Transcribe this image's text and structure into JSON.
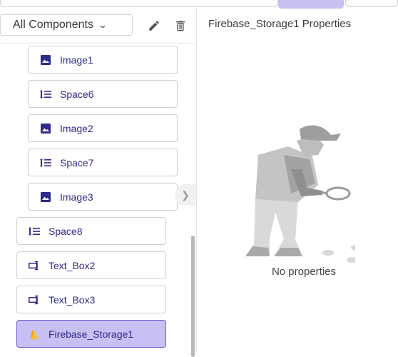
{
  "toolbar": {
    "filter_select": "All Components",
    "edit_icon": "pencil-icon",
    "delete_icon": "trash-icon"
  },
  "tree": {
    "items": [
      {
        "label": "Image1",
        "icon": "image-icon"
      },
      {
        "label": "Space6",
        "icon": "spacing-icon"
      },
      {
        "label": "Image2",
        "icon": "image-icon"
      },
      {
        "label": "Space7",
        "icon": "spacing-icon"
      },
      {
        "label": "Image3",
        "icon": "image-icon"
      },
      {
        "label": "Space8",
        "icon": "spacing-icon"
      },
      {
        "label": "Text_Box2",
        "icon": "textbox-icon"
      },
      {
        "label": "Text_Box3",
        "icon": "textbox-icon"
      },
      {
        "label": "Firebase_Storage1",
        "icon": "firebase-icon",
        "selected": true
      }
    ]
  },
  "properties": {
    "title": "Firebase_Storage1 Properties",
    "empty_text": "No properties"
  },
  "colors": {
    "accent": "#2f2a8a",
    "selected_bg": "#c8c0f4",
    "selected_border": "#6b5bd0"
  }
}
